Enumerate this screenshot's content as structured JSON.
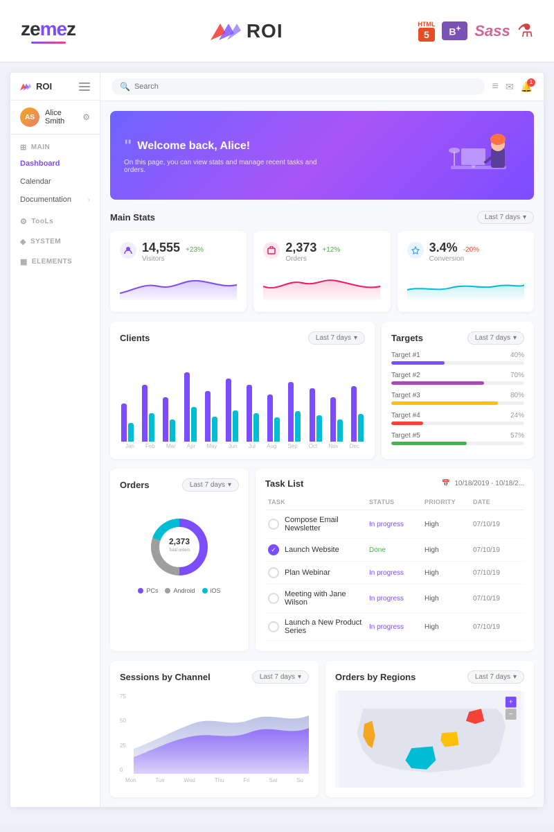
{
  "topBanner": {
    "zemes": "zemeZ",
    "roi": "ROI",
    "html": "HTML",
    "htmlBadge": "5",
    "bootstrapBadge": "B+",
    "sassBadge": "Sass",
    "gulpBadge": "☕"
  },
  "sidebar": {
    "logo": "ROI",
    "userName": "Alice Smith",
    "sections": {
      "main": "MAIN",
      "tools": "TooLs",
      "system": "SYSTEM",
      "elements": "ELEMENTS"
    },
    "navItems": {
      "dashboard": "Dashboard",
      "calendar": "Calendar",
      "documentation": "Documentation"
    }
  },
  "topbar": {
    "searchPlaceholder": "Search"
  },
  "welcome": {
    "greeting": "Welcome back, Alice!",
    "subtitle": "On this page, you can view stats and manage recent tasks and orders."
  },
  "mainStats": {
    "title": "Main Stats",
    "filter": "Last 7 days",
    "cards": [
      {
        "value": "14,555",
        "change": "+23%",
        "label": "Visitors",
        "icon": "👤",
        "iconColor": "purple"
      },
      {
        "value": "2,373",
        "change": "+12%",
        "label": "Orders",
        "icon": "📦",
        "iconColor": "pink"
      },
      {
        "value": "3.4%",
        "change": "-20%",
        "label": "Conversion",
        "icon": "⭐",
        "iconColor": "blue",
        "negative": true
      }
    ]
  },
  "clients": {
    "title": "Clients",
    "filter": "Last 7 days",
    "months": [
      "Jan",
      "Feb",
      "Mar",
      "Apr",
      "May",
      "Jun",
      "Jul",
      "Aug",
      "Sep",
      "Oct",
      "Nov",
      "Dec"
    ],
    "purpleBars": [
      60,
      90,
      70,
      110,
      80,
      100,
      90,
      75,
      95,
      85,
      70,
      88
    ],
    "cyanBars": [
      30,
      45,
      35,
      55,
      40,
      50,
      45,
      38,
      48,
      42,
      35,
      44
    ]
  },
  "targets": {
    "title": "Targets",
    "filter": "Last 7 days",
    "items": [
      {
        "name": "Target #1",
        "pct": 40,
        "color": "#7c4dff"
      },
      {
        "name": "Target #2",
        "pct": 70,
        "color": "#ab47bc"
      },
      {
        "name": "Target #3",
        "pct": 80,
        "color": "#ffc107"
      },
      {
        "name": "Target #4",
        "pct": 24,
        "color": "#f44336"
      },
      {
        "name": "Target #5",
        "pct": 57,
        "color": "#4caf50"
      }
    ]
  },
  "orders": {
    "title": "Orders",
    "filter": "Last 7 days",
    "totalValue": "2,373",
    "totalLabel": "Total orders",
    "legend": [
      {
        "label": "PCs",
        "color": "#7c4dff"
      },
      {
        "label": "Android",
        "color": "#9e9e9e"
      },
      {
        "label": "iOS",
        "color": "#00bcd4"
      }
    ]
  },
  "taskList": {
    "title": "Task List",
    "dateRange": "10/18/2019 - 10/18/2...",
    "columns": {
      "task": "TASK",
      "status": "STATUS",
      "priority": "PRIORITY",
      "date": "DATE"
    },
    "tasks": [
      {
        "name": "Compose Email Newsletter",
        "checked": false,
        "status": "In progress",
        "statusClass": "inprogress",
        "priority": "High",
        "date": "07/10/19"
      },
      {
        "name": "Launch Website",
        "checked": true,
        "status": "Done",
        "statusClass": "done",
        "priority": "High",
        "date": "07/10/19"
      },
      {
        "name": "Plan Webinar",
        "checked": false,
        "status": "In progress",
        "statusClass": "inprogress",
        "priority": "High",
        "date": "07/10/19"
      },
      {
        "name": "Meeting with Jane Wilson",
        "checked": false,
        "status": "In progress",
        "statusClass": "inprogress",
        "priority": "High",
        "date": "07/10/19"
      },
      {
        "name": "Launch a New Product Series",
        "checked": false,
        "status": "In progress",
        "statusClass": "inprogress",
        "priority": "High",
        "date": "07/10/19"
      }
    ]
  },
  "sessions": {
    "title": "Sessions by Channel",
    "filter": "Last 7 days",
    "yLabels": [
      "75",
      "50",
      "25",
      "0"
    ],
    "xLabels": [
      "Mon",
      "Tue",
      "Wed",
      "Thu",
      "Fri",
      "Sat",
      "Su"
    ]
  },
  "ordersRegions": {
    "title": "Orders by Regions",
    "filter": "Last 7 days"
  },
  "colors": {
    "brand": "#7c4dff",
    "accent": "#00bcd4",
    "purple": "#7c4dff",
    "pink": "#e91e63",
    "blue": "#2196f3",
    "green": "#4caf50",
    "red": "#f44336",
    "yellow": "#ffc107"
  }
}
